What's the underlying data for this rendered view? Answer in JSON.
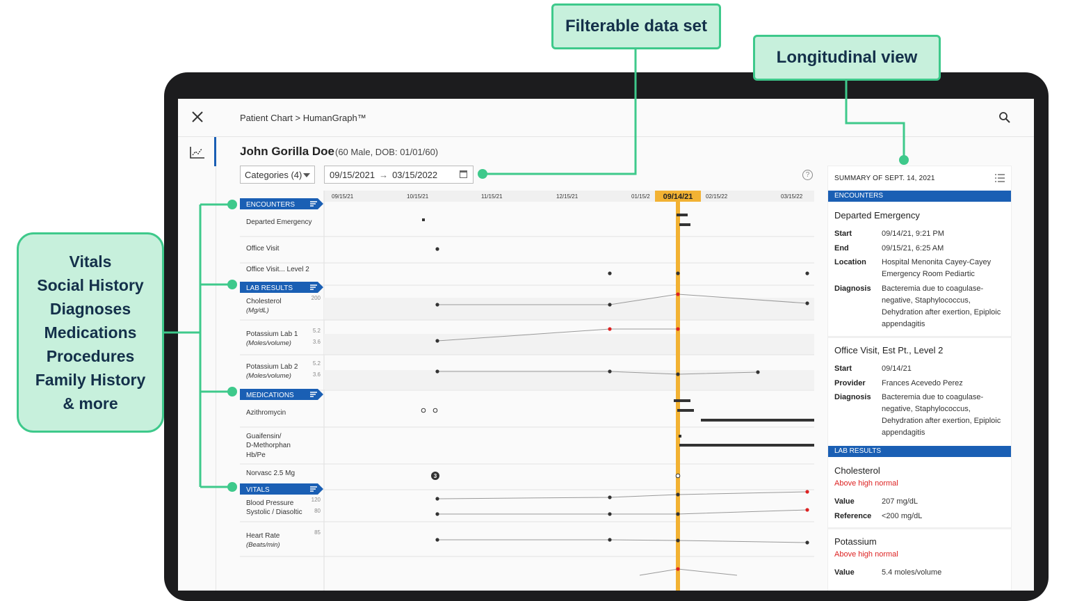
{
  "callouts": {
    "filter": "Filterable data set",
    "longitudinal": "Longitudinal view",
    "categories": [
      "Vitals",
      "Social History",
      "Diagnoses",
      "Medications",
      "Procedures",
      "Family History",
      "& more"
    ]
  },
  "topbar": {
    "breadcrumb": "Patient Chart > HumanGraph™",
    "close_icon": "close-icon",
    "search_icon": "search-icon"
  },
  "rail": {
    "icon": "chart-icon"
  },
  "patient": {
    "name": "John Gorilla Doe",
    "meta": "(60 Male, DOB: 01/01/60)"
  },
  "filters": {
    "categories_label": "Categories (4)",
    "date_from": "09/15/2021",
    "date_to": "03/15/2022"
  },
  "timeline": {
    "dates": [
      "09/15/21",
      "10/15/21",
      "11/15/21",
      "12/15/21",
      "01/15/2",
      "02/15/22",
      "03/15/22"
    ],
    "selected_date": "09/14/21",
    "sections": [
      "ENCOUNTERS",
      "LAB RESULTS",
      "MEDICATIONS",
      "VITALS"
    ],
    "rows": [
      {
        "label": "Departed Emergency"
      },
      {
        "label": "Office Visit"
      },
      {
        "label": "Office Visit... Level 2"
      },
      {
        "label": "Cholesterol",
        "sub": "(Mg/dL)",
        "ticks": [
          "200"
        ]
      },
      {
        "label": "Potassium Lab 1",
        "sub": "(Moles/volume)",
        "ticks": [
          "5.2",
          "3.6"
        ]
      },
      {
        "label": "Potassium Lab 2",
        "sub": "(Moles/volume)",
        "ticks": [
          "5.2",
          "3.6"
        ]
      },
      {
        "label": "Azithromycin"
      },
      {
        "label": "Guaifensin/",
        "sub2": "D-Methorphan",
        "sub3": "Hb/Pe"
      },
      {
        "label": "Norvasc 2.5 Mg",
        "badge": "3"
      },
      {
        "label": "Blood Pressure",
        "sub2": "Systolic / Diasoltic",
        "ticks": [
          "120",
          "80"
        ]
      },
      {
        "label": "Heart Rate",
        "sub": "(Beats/min)",
        "ticks": [
          "85"
        ]
      }
    ]
  },
  "summary": {
    "title": "SUMMARY OF SEPT. 14, 2021",
    "encounters_band": "ENCOUNTERS",
    "lab_band": "LAB RESULTS",
    "enc1": {
      "title": "Departed Emergency",
      "start_k": "Start",
      "start_v": "09/14/21, 9:21 PM",
      "end_k": "End",
      "end_v": "09/15/21, 6:25 AM",
      "loc_k": "Location",
      "loc_v": "Hospital Menonita Cayey-Cayey Emergency Room Pediartic",
      "diag_k": "Diagnosis",
      "diag_v": "Bacteremia due to coagulase-negative, Staphylococcus, Dehydration after exertion, Epiploic appendagitis"
    },
    "enc2": {
      "title": "Office Visit, Est Pt., Level 2",
      "start_k": "Start",
      "start_v": "09/14/21",
      "prov_k": "Provider",
      "prov_v": "Frances Acevedo Perez",
      "diag_k": "Diagnosis",
      "diag_v": "Bacteremia due to coagulase-negative, Staphylococcus, Dehydration after exertion, Epiploic appendagitis"
    },
    "lab1": {
      "title": "Cholesterol",
      "flag": "Above high normal",
      "val_k": "Value",
      "val_v": "207 mg/dL",
      "ref_k": "Reference",
      "ref_v": "<200 mg/dL"
    },
    "lab2": {
      "title": "Potassium",
      "flag": "Above high normal",
      "val_k": "Value",
      "val_v": "5.4 moles/volume"
    }
  },
  "colors": {
    "accent_blue": "#1a5fb4",
    "marker_orange": "#f2b233",
    "callout_green": "#3ec98b",
    "callout_fill": "#c7f0dc",
    "alert_red": "#dd2222"
  }
}
